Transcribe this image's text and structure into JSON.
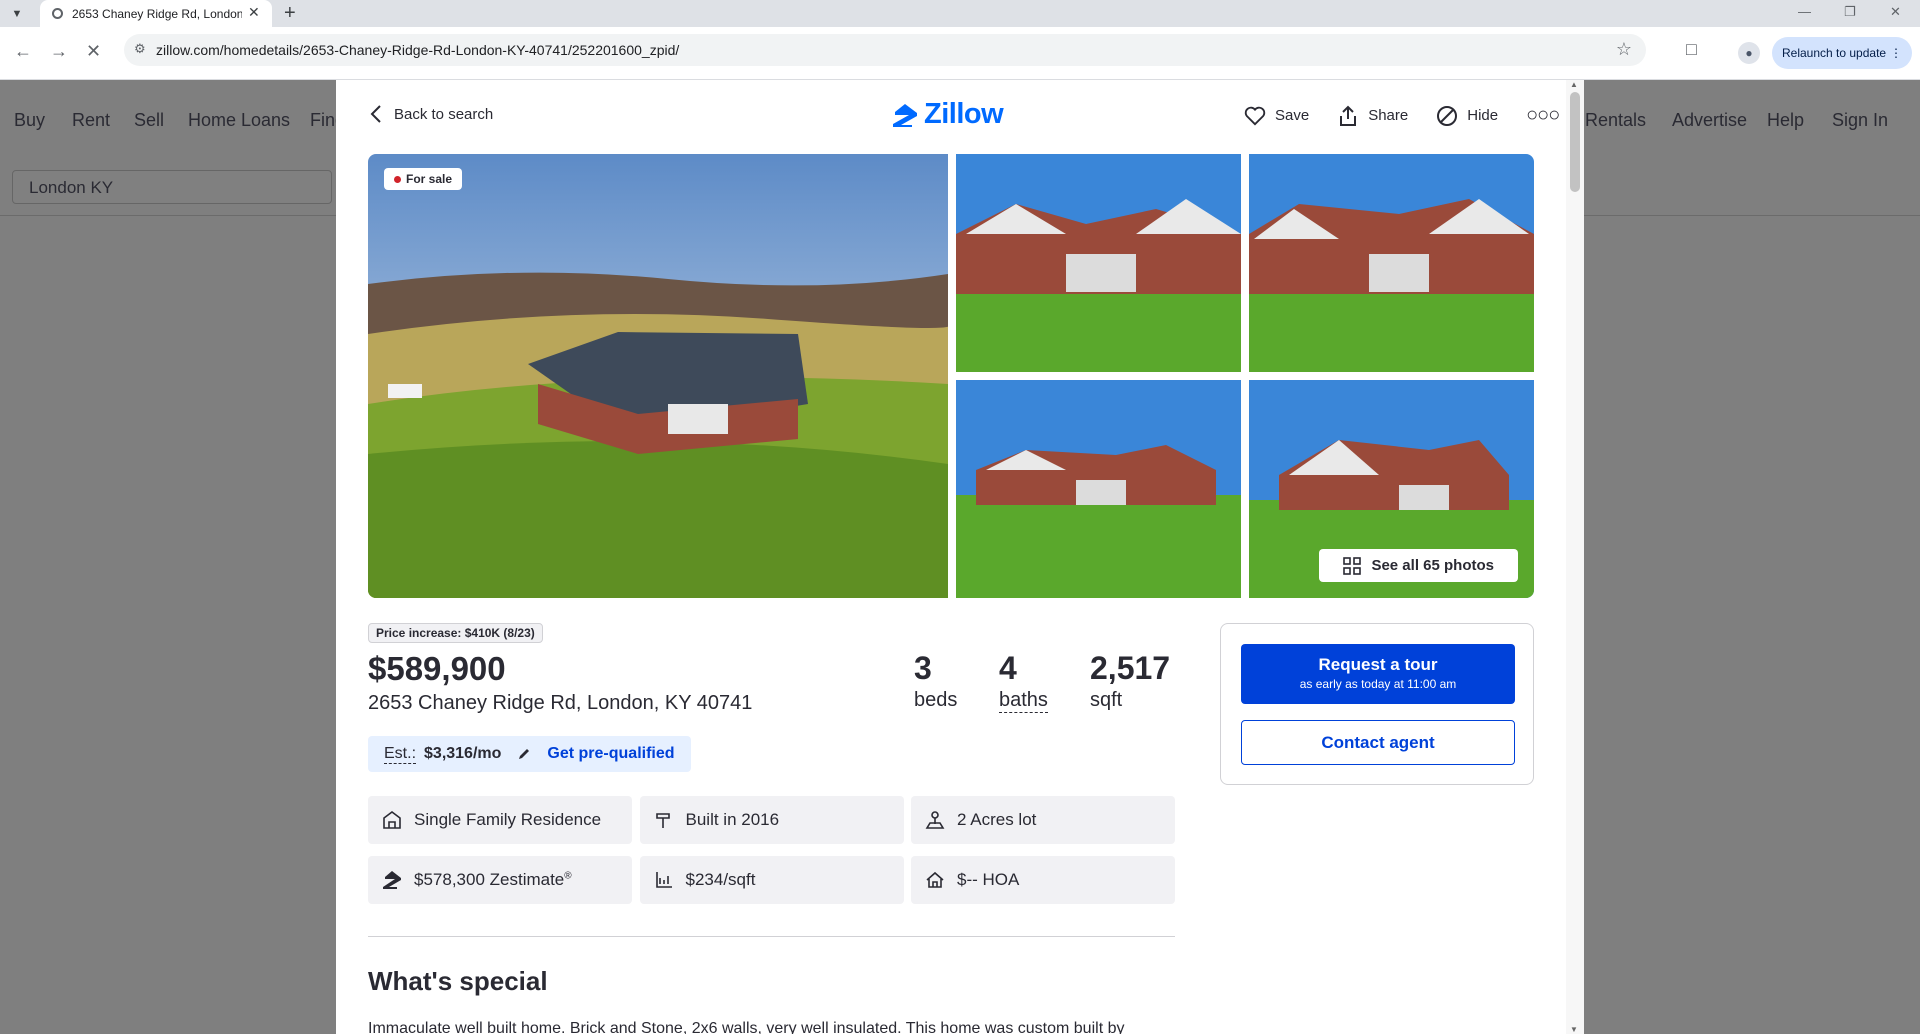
{
  "browser": {
    "tab_title": "2653 Chaney Ridge Rd, London",
    "url": "zillow.com/homedetails/2653-Chaney-Ridge-Rd-London-KY-40741/252201600_zpid/",
    "relaunch_label": "Relaunch to update"
  },
  "background_page": {
    "nav_left": [
      "Buy",
      "Rent",
      "Sell",
      "Home Loans",
      "Find"
    ],
    "nav_right": [
      "Rentals",
      "Advertise",
      "Help",
      "Sign In"
    ],
    "search_value": "London KY"
  },
  "header": {
    "back_label": "Back to search",
    "logo_text": "Zillow",
    "save_label": "Save",
    "share_label": "Share",
    "hide_label": "Hide"
  },
  "gallery": {
    "status_badge": "For sale",
    "see_all_label": "See all 65 photos"
  },
  "listing": {
    "price_change": "Price increase: $410K (8/23)",
    "price": "$589,900",
    "address": "2653 Chaney Ridge Rd, London, KY 40741",
    "beds_value": "3",
    "beds_label": "beds",
    "baths_value": "4",
    "baths_label": "baths",
    "sqft_value": "2,517",
    "sqft_label": "sqft",
    "est_label": "Est.:",
    "est_amount": "$3,316/mo",
    "prequal_label": "Get pre-qualified"
  },
  "facts": [
    {
      "icon": "house-type-icon",
      "label": "Single Family Residence"
    },
    {
      "icon": "hammer-icon",
      "label": "Built in 2016"
    },
    {
      "icon": "lot-size-icon",
      "label": "2 Acres lot"
    },
    {
      "icon": "zestimate-icon",
      "label": "$578,300 Zestimate",
      "sup": "®"
    },
    {
      "icon": "price-per-sqft-icon",
      "label": "$234/sqft"
    },
    {
      "icon": "hoa-icon",
      "label": "$-- HOA"
    }
  ],
  "whats_special": {
    "heading": "What's special",
    "text": "Immaculate well built home. Brick and Stone, 2x6 walls, very well insulated. This home was custom built by"
  },
  "contact": {
    "tour_label": "Request a tour",
    "tour_sub": "as early as today at 11:00 am",
    "agent_label": "Contact agent"
  },
  "colors": {
    "brand": "#006aff",
    "primary_button": "#0041d9",
    "for_sale_dot": "#d1232a"
  }
}
